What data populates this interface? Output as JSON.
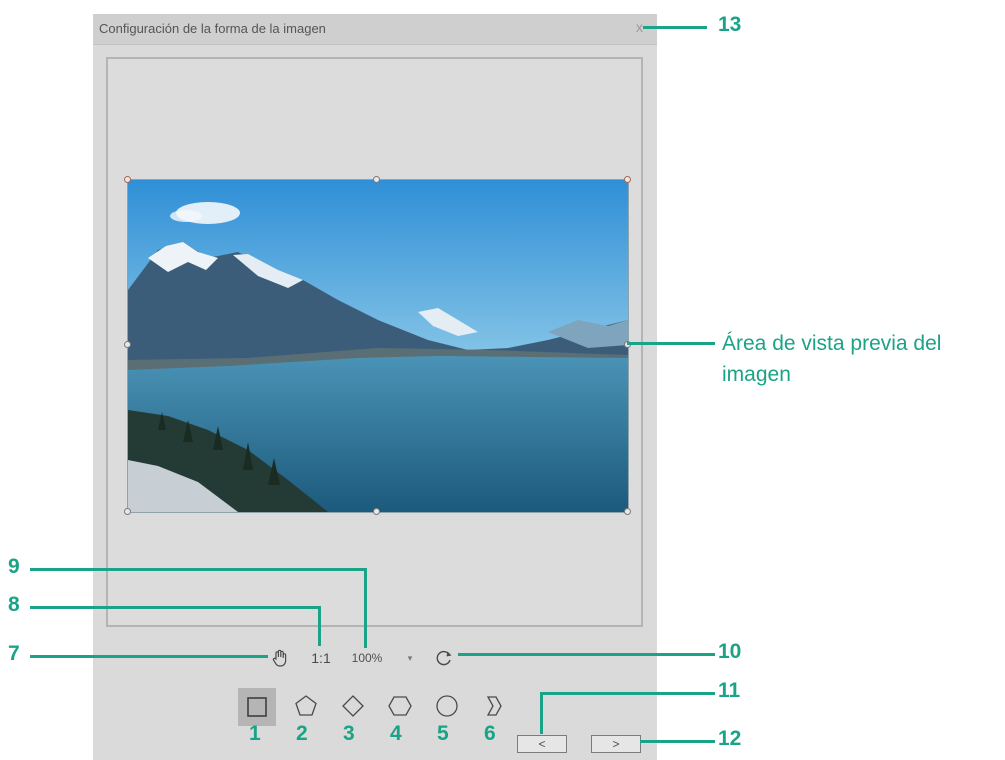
{
  "dialog": {
    "title": "Configuración de la forma de la imagen",
    "close_glyph": "x"
  },
  "toolbar": {
    "pan_icon": "hand-icon",
    "ratio_label": "1:1",
    "zoom_value": "100%",
    "zoom_dropdown_glyph": "▾",
    "reset_icon": "rotate-reset-icon"
  },
  "shapes": [
    {
      "name": "square",
      "selected": true
    },
    {
      "name": "pentagon",
      "selected": false
    },
    {
      "name": "diamond",
      "selected": false
    },
    {
      "name": "hexagon",
      "selected": false
    },
    {
      "name": "circle",
      "selected": false
    },
    {
      "name": "tag",
      "selected": false
    }
  ],
  "nav": {
    "prev_label": "<",
    "next_label": ">"
  },
  "annotations": {
    "preview_label_line1": "Área de vista previa del",
    "preview_label_line2": "imagen",
    "n1": "1",
    "n2": "2",
    "n3": "3",
    "n4": "4",
    "n5": "5",
    "n6": "6",
    "n7": "7",
    "n8": "8",
    "n9": "9",
    "n10": "10",
    "n11": "11",
    "n12": "12",
    "n13": "13",
    "color": "#1aa386"
  }
}
